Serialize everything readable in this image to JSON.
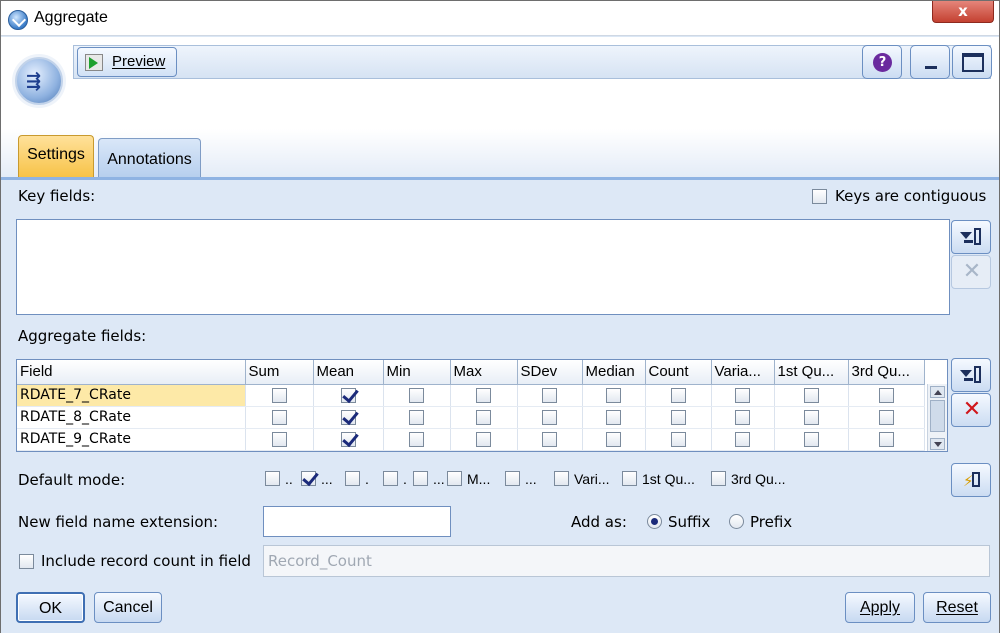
{
  "window": {
    "title": "Aggregate",
    "close_label": "x"
  },
  "toolbar": {
    "preview_label": "Preview",
    "help_label": "?"
  },
  "tabs": [
    {
      "label": "Settings",
      "active": true
    },
    {
      "label": "Annotations",
      "active": false
    }
  ],
  "key_fields": {
    "label": "Key fields:",
    "contiguous_label": "Keys are contiguous",
    "contiguous_checked": false,
    "items": []
  },
  "aggregate_fields": {
    "label": "Aggregate fields:",
    "columns": [
      "Field",
      "Sum",
      "Mean",
      "Min",
      "Max",
      "SDev",
      "Median",
      "Count",
      "Varia...",
      "1st Qu...",
      "3rd Qu..."
    ],
    "rows": [
      {
        "field": "RDATE_7_CRate",
        "checks": [
          false,
          true,
          false,
          false,
          false,
          false,
          false,
          false,
          false,
          false
        ],
        "selected": true
      },
      {
        "field": "RDATE_8_CRate",
        "checks": [
          false,
          true,
          false,
          false,
          false,
          false,
          false,
          false,
          false,
          false
        ],
        "selected": false
      },
      {
        "field": "RDATE_9_CRate",
        "checks": [
          false,
          true,
          false,
          false,
          false,
          false,
          false,
          false,
          false,
          false
        ],
        "selected": false
      }
    ]
  },
  "default_mode": {
    "label": "Default mode:",
    "options": [
      {
        "label": "..",
        "checked": false
      },
      {
        "label": "...",
        "checked": true
      },
      {
        "label": ".",
        "checked": false
      },
      {
        "label": ".",
        "checked": false
      },
      {
        "label": "...",
        "checked": false
      },
      {
        "label": "M...",
        "checked": false
      },
      {
        "label": "...",
        "checked": false
      },
      {
        "label": "Vari...",
        "checked": false
      },
      {
        "label": "1st Qu...",
        "checked": false
      },
      {
        "label": "3rd Qu...",
        "checked": false
      }
    ]
  },
  "extension": {
    "label": "New field name extension:",
    "value": ""
  },
  "add_as": {
    "label": "Add as:",
    "suffix_label": "Suffix",
    "prefix_label": "Prefix",
    "selected": "Suffix"
  },
  "record_count": {
    "label": "Include record count in field",
    "checked": false,
    "value": "Record_Count"
  },
  "buttons": {
    "ok": "OK",
    "cancel": "Cancel",
    "apply": "Apply",
    "reset": "Reset"
  },
  "colors": {
    "active_tab": "#f7c348",
    "panel": "#dde8f6",
    "selected_row": "#fde9a7",
    "delete_red": "#d0161b"
  }
}
